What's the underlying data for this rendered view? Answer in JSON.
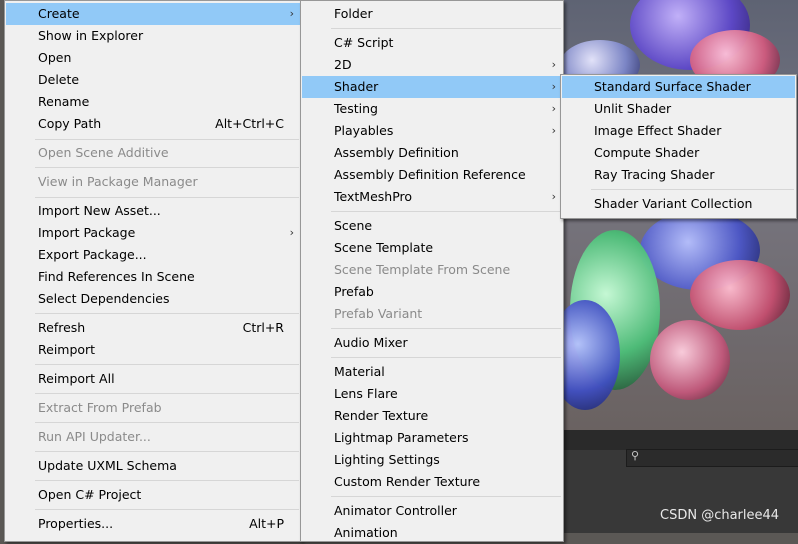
{
  "menu_main": {
    "items": [
      {
        "label": "Create",
        "arrow": "›"
      },
      {
        "label": "Show in Explorer"
      },
      {
        "label": "Open"
      },
      {
        "label": "Delete"
      },
      {
        "label": "Rename"
      },
      {
        "label": "Copy Path",
        "shortcut": "Alt+Ctrl+C"
      },
      {
        "label": "Open Scene Additive"
      },
      {
        "label": "View in Package Manager"
      },
      {
        "label": "Import New Asset..."
      },
      {
        "label": "Import Package",
        "arrow": "›"
      },
      {
        "label": "Export Package..."
      },
      {
        "label": "Find References In Scene"
      },
      {
        "label": "Select Dependencies"
      },
      {
        "label": "Refresh",
        "shortcut": "Ctrl+R"
      },
      {
        "label": "Reimport"
      },
      {
        "label": "Reimport All"
      },
      {
        "label": "Extract From Prefab"
      },
      {
        "label": "Run API Updater..."
      },
      {
        "label": "Update UXML Schema"
      },
      {
        "label": "Open C# Project"
      },
      {
        "label": "Properties...",
        "shortcut": "Alt+P"
      }
    ]
  },
  "menu_create": {
    "items": [
      {
        "label": "Folder"
      },
      {
        "label": "C# Script"
      },
      {
        "label": "2D",
        "arrow": "›"
      },
      {
        "label": "Shader",
        "arrow": "›"
      },
      {
        "label": "Testing",
        "arrow": "›"
      },
      {
        "label": "Playables",
        "arrow": "›"
      },
      {
        "label": "Assembly Definition"
      },
      {
        "label": "Assembly Definition Reference"
      },
      {
        "label": "TextMeshPro",
        "arrow": "›"
      },
      {
        "label": "Scene"
      },
      {
        "label": "Scene Template"
      },
      {
        "label": "Scene Template From Scene"
      },
      {
        "label": "Prefab"
      },
      {
        "label": "Prefab Variant"
      },
      {
        "label": "Audio Mixer"
      },
      {
        "label": "Material"
      },
      {
        "label": "Lens Flare"
      },
      {
        "label": "Render Texture"
      },
      {
        "label": "Lightmap Parameters"
      },
      {
        "label": "Lighting Settings"
      },
      {
        "label": "Custom Render Texture"
      },
      {
        "label": "Animator Controller"
      },
      {
        "label": "Animation"
      }
    ]
  },
  "menu_shader": {
    "items": [
      {
        "label": "Standard Surface Shader"
      },
      {
        "label": "Unlit Shader"
      },
      {
        "label": "Image Effect Shader"
      },
      {
        "label": "Compute Shader"
      },
      {
        "label": "Ray Tracing Shader"
      },
      {
        "label": "Shader Variant Collection"
      }
    ]
  },
  "watermark": "CSDN @charlee44",
  "search_icon": "⚲",
  "colors": {
    "highlight": "#91c9f7",
    "menu_bg": "#f0f0f0",
    "disabled_text": "#8a8a8a"
  }
}
